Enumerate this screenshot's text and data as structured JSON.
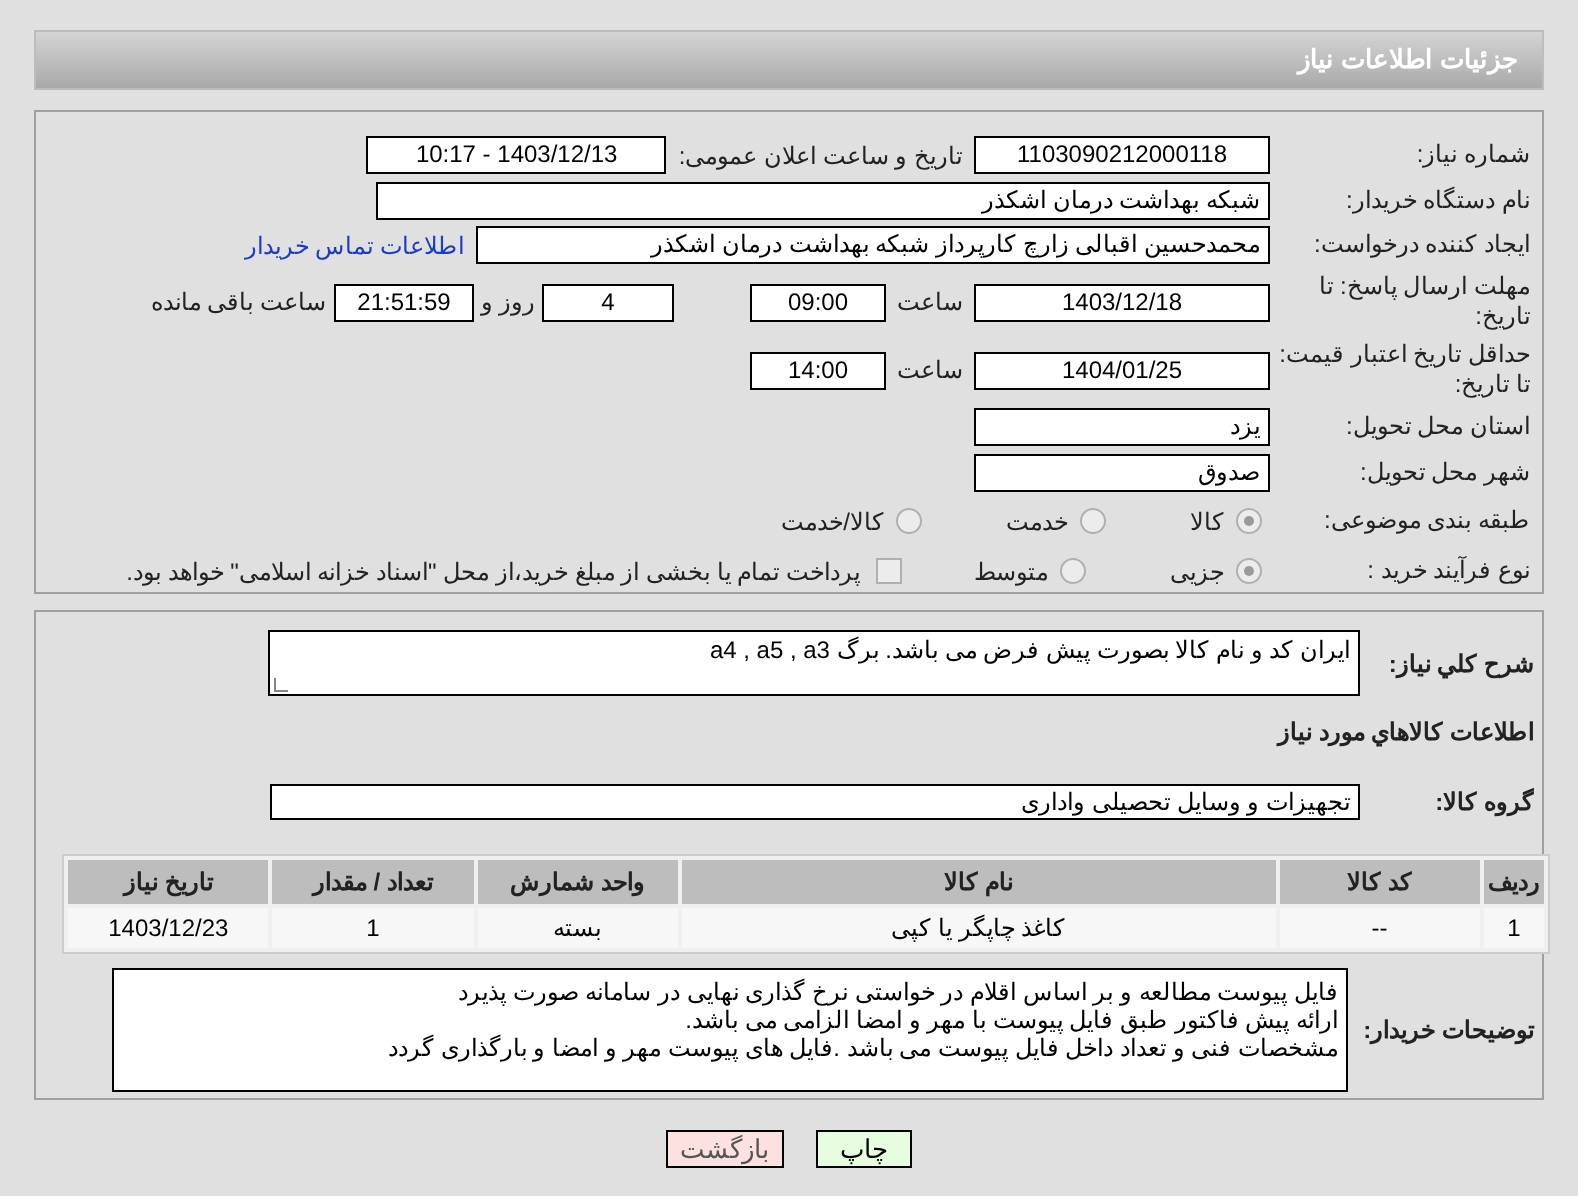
{
  "header": {
    "title": "جزئیات اطلاعات نیاز"
  },
  "need_number": {
    "label": "شماره نیاز:",
    "value": "1103090212000118"
  },
  "announce": {
    "label": "تاریخ و ساعت اعلان عمومی:",
    "value": "1403/12/13 - 10:17"
  },
  "buyer_org": {
    "label": "نام دستگاه خریدار:",
    "value": "شبکه بهداشت درمان اشکذر"
  },
  "requester": {
    "label": "ایجاد کننده درخواست:",
    "value": "محمدحسین اقبالی زارچ کارپرداز شبکه بهداشت درمان اشکذر",
    "link": "اطلاعات تماس خریدار"
  },
  "response_deadline": {
    "label": "مهلت ارسال پاسخ: تا تاریخ:",
    "date": "1403/12/18",
    "time_label": "ساعت",
    "time": "09:00",
    "days": "4",
    "days_label": "روز و",
    "remaining": "21:51:59",
    "remaining_label": "ساعت باقی مانده"
  },
  "price_validity": {
    "label": "حداقل تاریخ اعتبار قیمت: تا تاریخ:",
    "date": "1404/01/25",
    "time_label": "ساعت",
    "time": "14:00"
  },
  "province": {
    "label": "استان محل تحویل:",
    "value": "یزد"
  },
  "city": {
    "label": "شهر محل تحویل:",
    "value": "صدوق"
  },
  "category": {
    "label": "طبقه بندی موضوعی:",
    "options": [
      {
        "label": "کالا",
        "selected": true
      },
      {
        "label": "خدمت",
        "selected": false
      },
      {
        "label": "کالا/خدمت",
        "selected": false
      }
    ]
  },
  "process": {
    "label": "نوع فرآیند خرید :",
    "options": [
      {
        "label": "جزیی",
        "selected": true
      },
      {
        "label": "متوسط",
        "selected": false
      }
    ],
    "payment_note": {
      "label": "پرداخت تمام یا بخشی از مبلغ خرید،از محل \"اسناد خزانه اسلامی\" خواهد بود.",
      "checked": false
    }
  },
  "description": {
    "label": "شرح کلي نياز:",
    "value": "ایران کد و نام کالا بصورت پیش فرض می باشد. برگ a4 , a5 , a3"
  },
  "goods_title": "اطلاعات کالاهاي مورد نياز",
  "goods_group": {
    "label": "گروه کالا:",
    "value": "تجهیزات و وسایل تحصیلی واداری"
  },
  "table": {
    "columns": [
      "ردیف",
      "کد کالا",
      "نام کالا",
      "واحد شمارش",
      "تعداد / مقدار",
      "تاریخ نیاز"
    ],
    "rows": [
      [
        "1",
        "--",
        "کاغذ چاپگر یا کپی",
        "بسته",
        "1",
        "1403/12/23"
      ]
    ]
  },
  "buyer_notes": {
    "label": "توضیحات خریدار:",
    "lines": [
      "فایل پیوست مطالعه و بر اساس اقلام در خواستی نرخ گذاری نهایی در سامانه صورت پذیرد",
      "ارائه پیش فاکتور طبق فایل پیوست با مهر و امضا الزامی می باشد.",
      "مشخصات فنی و تعداد داخل فایل پیوست می باشد .فایل های پیوست مهر و امضا و بارگذاری گردد"
    ]
  },
  "buttons": [
    {
      "label": "چاپ",
      "kind": "print"
    },
    {
      "label": "بازگشت",
      "kind": "back"
    }
  ]
}
